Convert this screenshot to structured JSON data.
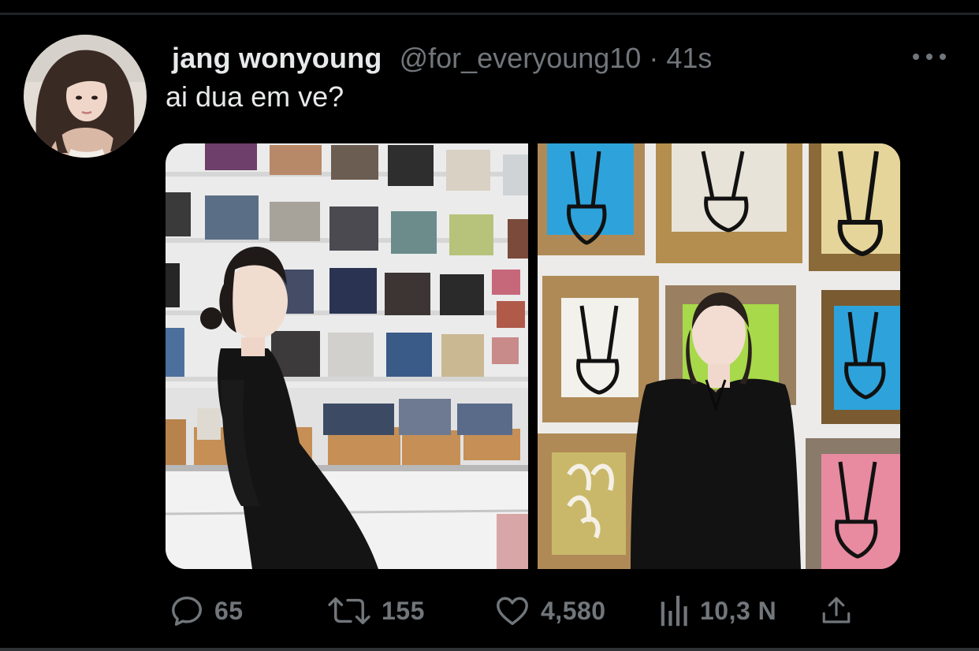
{
  "tweet": {
    "author_name": "jang wonyoung",
    "handle": "@for_everyoung10",
    "separator": "·",
    "timestamp": "41s",
    "text": "ai dua em ve?"
  },
  "media": {
    "count": 2,
    "left_photo": "woman-in-record-store",
    "right_photo": "woman-with-rabbit-paintings"
  },
  "actions": {
    "reply": {
      "icon": "reply-icon",
      "count": "65"
    },
    "retweet": {
      "icon": "retweet-icon",
      "count": "155"
    },
    "like": {
      "icon": "heart-icon",
      "count": "4,580"
    },
    "views": {
      "icon": "views-icon",
      "count": "10,3 N"
    },
    "share": {
      "icon": "share-icon"
    }
  },
  "menu": {
    "icon": "more-icon"
  },
  "colors": {
    "background": "#000000",
    "text_primary": "#e7e9ea",
    "text_secondary": "#71767b",
    "divider": "#2f3336"
  }
}
